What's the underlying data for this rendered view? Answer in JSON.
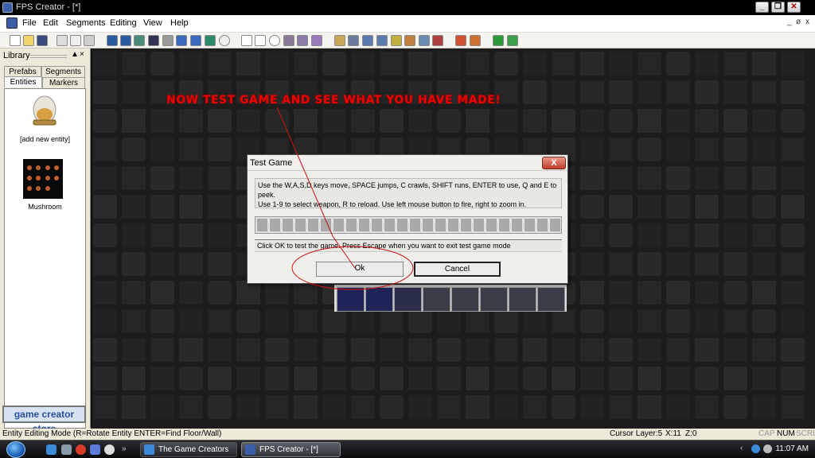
{
  "window": {
    "title": "FPS Creator - [*]",
    "controls": [
      "_",
      "❐",
      "✕"
    ]
  },
  "menubar": {
    "items": [
      "File",
      "Edit",
      "Segments",
      "Editing",
      "View",
      "Help"
    ],
    "mdi_controls": [
      "_",
      "ø",
      "x"
    ]
  },
  "library": {
    "title": "Library",
    "controls": [
      "▲",
      "×"
    ],
    "tabs": [
      "Prefabs",
      "Segments",
      "Entities",
      "Markers"
    ],
    "entities": [
      {
        "label": "[add new entity]",
        "icon": "bell-jar-icon"
      },
      {
        "label": "Mushroom",
        "icon": "mushroom-thumbnail"
      }
    ],
    "store_button": "game creator store"
  },
  "canvas": {
    "headline": "NOW TEST GAME AND SEE WHAT YOU HAVE MADE!"
  },
  "dialog": {
    "title": "Test Game",
    "close_label": "X",
    "instructions_line1": "Use the W,A,S,D keys move, SPACE jumps, C crawls, SHIFT runs, ENTER to use, Q and E to peek.",
    "instructions_line2": "Use 1-9 to select weapon, R to reload. Use left mouse button to fire, right to zoom in.",
    "status": "Click OK to test the game. Press Escape when you want to exit test game mode",
    "ok_label": "Ok",
    "cancel_label": "Cancel"
  },
  "statusbar": {
    "mode": "Entity Editing Mode (R=Rotate Entity  ENTER=Find Floor/Wall)",
    "cursor_layer": "Cursor Layer:5",
    "x": "X:11",
    "z": "Z:0",
    "cap": "CAP",
    "num": "NUM",
    "scrl": "SCRL"
  },
  "taskbar": {
    "tasks": [
      "The Game Creators F...",
      "FPS Creator - [*]"
    ],
    "clock": "11:07 AM"
  },
  "colors": {
    "headline": "#ee0000",
    "annotation": "#cc1111",
    "canvas_bg": "#1c1c1c"
  }
}
